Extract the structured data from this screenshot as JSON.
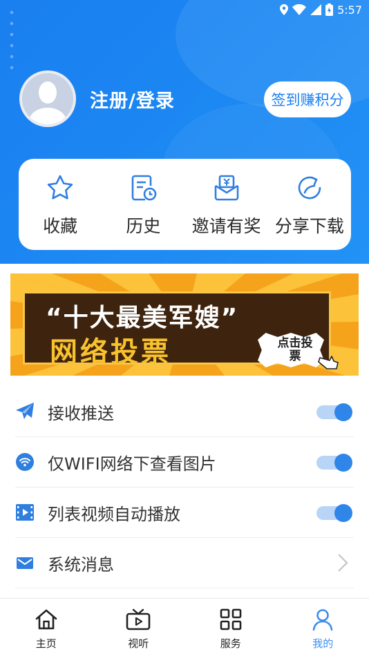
{
  "status_bar": {
    "time": "5:57"
  },
  "header": {
    "login_label": "注册/登录",
    "checkin_label": "签到赚积分"
  },
  "quick_actions": [
    {
      "label": "收藏",
      "icon": "star-icon"
    },
    {
      "label": "历史",
      "icon": "history-icon"
    },
    {
      "label": "邀请有奖",
      "icon": "invite-reward-icon"
    },
    {
      "label": "分享下载",
      "icon": "share-icon"
    }
  ],
  "banner": {
    "line1": "“十大最美军嫂”",
    "line2": "网络投票",
    "badge": "点击投票"
  },
  "settings": [
    {
      "label": "接收推送",
      "icon": "send-icon",
      "control": "toggle",
      "on": true
    },
    {
      "label": "仅WIFI网络下查看图片",
      "icon": "wifi-icon",
      "control": "toggle",
      "on": true
    },
    {
      "label": "列表视频自动播放",
      "icon": "video-icon",
      "control": "toggle",
      "on": true
    },
    {
      "label": "系统消息",
      "icon": "mail-icon",
      "control": "chevron"
    }
  ],
  "bottom_nav": [
    {
      "label": "主页",
      "icon": "home-icon",
      "active": false
    },
    {
      "label": "视听",
      "icon": "tv-icon",
      "active": false
    },
    {
      "label": "服务",
      "icon": "grid-icon",
      "active": false
    },
    {
      "label": "我的",
      "icon": "user-icon",
      "active": true
    }
  ],
  "colors": {
    "brand_blue": "#1a7ff0",
    "toggle_on": "#2f86e8",
    "toggle_track": "#b8d4f6",
    "active_nav": "#3a8ef0"
  }
}
